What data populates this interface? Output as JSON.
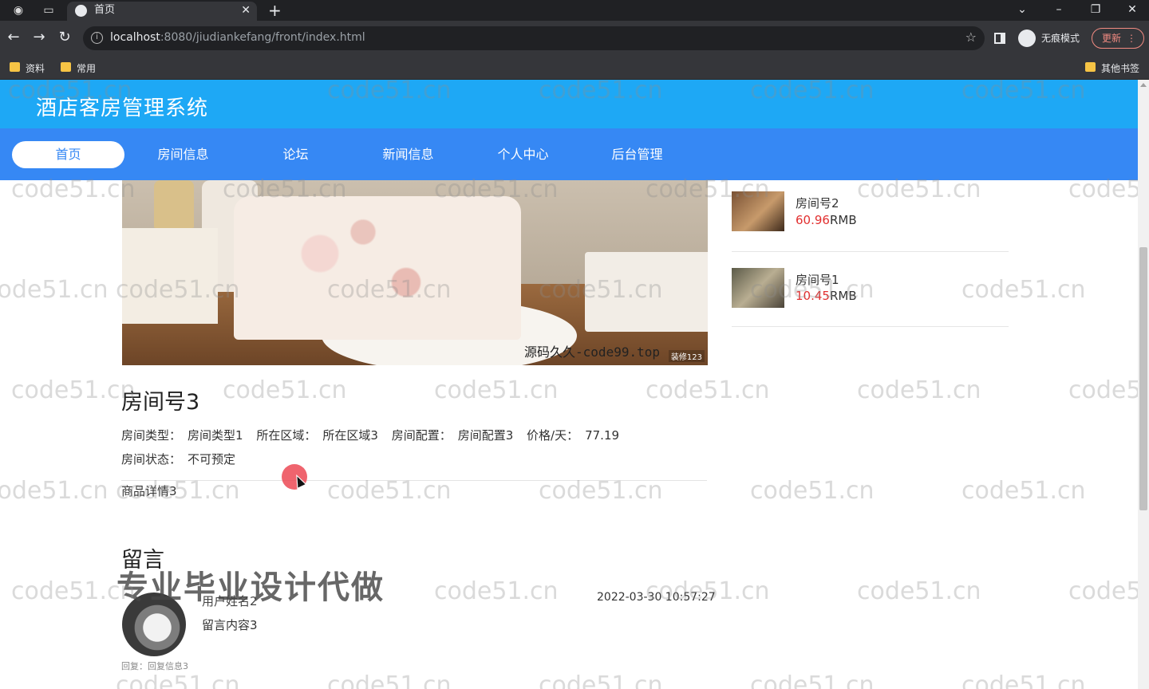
{
  "browser": {
    "tab_title": "首页",
    "new_tab_symbol": "+",
    "url_host": "localhost",
    "url_path": ":8080/jiudiankefang/front/index.html",
    "incognito_label": "无痕模式",
    "update_label": "更新",
    "bookmarks": [
      "资料",
      "常用"
    ],
    "other_bookmarks": "其他书签",
    "icons": [
      "back-icon",
      "forward-icon",
      "reload-icon",
      "info-icon",
      "star-icon",
      "side-panel-icon",
      "incognito-icon"
    ]
  },
  "site": {
    "title": "酒店客房管理系统",
    "nav": [
      "首页",
      "房间信息",
      "论坛",
      "新闻信息",
      "个人中心",
      "后台管理"
    ],
    "active_nav": "首页"
  },
  "hero": {
    "watermark": "源码久久-code99.top",
    "badge": "装修123"
  },
  "side_rooms": [
    {
      "name": "房间号2",
      "price": "60.96",
      "unit": "RMB"
    },
    {
      "name": "房间号1",
      "price": "10.45",
      "unit": "RMB"
    }
  ],
  "room": {
    "title": "房间号3",
    "type_label": "房间类型：",
    "type_value": "房间类型1",
    "area_label": "所在区域：",
    "area_value": "所在区域3",
    "config_label": "房间配置：",
    "config_value": "房间配置3",
    "price_label": "价格/天：",
    "price_value": "77.19",
    "status_label": "房间状态：",
    "status_value": "不可预定",
    "detail": "商品详情3"
  },
  "messages": {
    "heading": "留言",
    "items": [
      {
        "user": "用户姓名2",
        "content": "留言内容3",
        "time": "2022-03-30 10:57:27",
        "reply": "回复：回复信息3"
      }
    ]
  },
  "overlay": {
    "promo_text": "专业毕业设计代做",
    "watermark": "code51.cn"
  },
  "colors": {
    "header_bg": "#1ea8f5",
    "nav_bg": "#3688f4",
    "price_red": "#e23030"
  }
}
